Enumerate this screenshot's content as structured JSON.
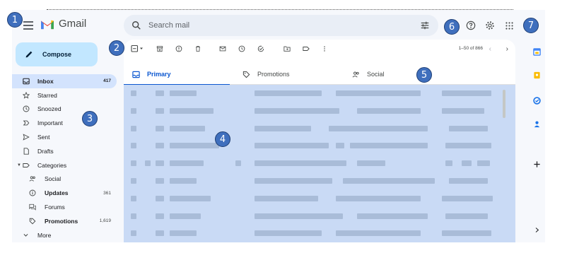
{
  "app": {
    "logo_text": "Gmail"
  },
  "search": {
    "placeholder": "Search mail"
  },
  "compose": {
    "label": "Compose"
  },
  "nav": {
    "items": [
      {
        "label": "Inbox",
        "count": "417",
        "icon": "inbox-icon",
        "active": true
      },
      {
        "label": "Starred",
        "count": "",
        "icon": "star-icon"
      },
      {
        "label": "Snoozed",
        "count": "",
        "icon": "clock-icon"
      },
      {
        "label": "Important",
        "count": "",
        "icon": "important-icon"
      },
      {
        "label": "Sent",
        "count": "",
        "icon": "send-icon"
      },
      {
        "label": "Drafts",
        "count": "",
        "icon": "draft-icon"
      },
      {
        "label": "Categories",
        "count": "",
        "icon": "label-icon"
      },
      {
        "label": "Social",
        "count": "",
        "icon": "people-icon"
      },
      {
        "label": "Updates",
        "count": "361",
        "icon": "info-icon"
      },
      {
        "label": "Forums",
        "count": "",
        "icon": "forum-icon"
      },
      {
        "label": "Promotions",
        "count": "1,619",
        "icon": "tag-icon"
      },
      {
        "label": "More",
        "count": "",
        "icon": "chevron-down-icon"
      }
    ]
  },
  "toolbar": {
    "pager": "1–50 of 866"
  },
  "tabs": [
    {
      "label": "Primary",
      "icon": "inbox-icon",
      "active": true
    },
    {
      "label": "Promotions",
      "icon": "tag-icon"
    },
    {
      "label": "Social",
      "icon": "people-icon"
    }
  ],
  "callouts": [
    "1",
    "2",
    "3",
    "4",
    "5",
    "6",
    "7"
  ],
  "colors": {
    "accent": "#0b57d0",
    "compose_bg": "#c2e7ff",
    "nav_active": "#d3e3fd",
    "email_overlay": "#c9daf5",
    "callout": "#3f6fbd"
  }
}
